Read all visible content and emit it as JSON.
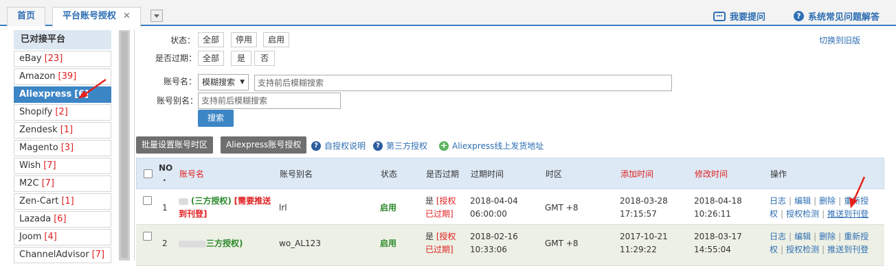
{
  "tabs": {
    "home": "首页",
    "active": "平台账号授权",
    "close": "✕"
  },
  "top_links": {
    "ask": "我要提问",
    "faq": "系统常见问题解答"
  },
  "sidebar": {
    "title": "已对接平台",
    "items": [
      {
        "name": "eBay",
        "count": "[23]"
      },
      {
        "name": "Amazon",
        "count": "[39]"
      },
      {
        "name": "Aliexpress",
        "count": "[6]"
      },
      {
        "name": "Shopify",
        "count": "[2]"
      },
      {
        "name": "Zendesk",
        "count": "[1]"
      },
      {
        "name": "Magento",
        "count": "[3]"
      },
      {
        "name": "Wish",
        "count": "[7]"
      },
      {
        "name": "M2C",
        "count": "[7]"
      },
      {
        "name": "Zen-Cart",
        "count": "[1]"
      },
      {
        "name": "Lazada",
        "count": "[6]"
      },
      {
        "name": "Joom",
        "count": "[4]"
      },
      {
        "name": "ChannelAdvisor",
        "count": "[7]"
      }
    ]
  },
  "filters": {
    "status_label": "状态：",
    "status_options": [
      "全部",
      "停用",
      "启用"
    ],
    "expired_label": "是否过期：",
    "expired_options": [
      "全部",
      "是",
      "否"
    ],
    "account_label": "账号名：",
    "search_mode": "模糊搜索",
    "account_placeholder": "支持前后模糊搜索",
    "alias_label": "账号别名：",
    "alias_placeholder": "支持前后模糊搜索",
    "search_button": "搜索",
    "switch_old": "切换到旧版"
  },
  "toolbar": {
    "batch_timezone": "批量设置账号时区",
    "aliexpress_auth": "Aliexpress账号授权",
    "self_auth": "自授权说明",
    "third_auth": "第三方授权",
    "ship_address": "Aliexpress线上发货地址"
  },
  "table": {
    "headers": {
      "no_top": "NO",
      "no_dot": ".",
      "account": "账号名",
      "alias": "账号别名",
      "status": "状态",
      "expired": "是否过期",
      "expire_time": "过期时间",
      "timezone": "时区",
      "added": "添加时间",
      "modified": "修改时间",
      "ops": "操作"
    },
    "rows": [
      {
        "no": "1",
        "account_tag": "(三方授权)",
        "account_note": "[需要推送到刊登]",
        "alias": "lrl",
        "status": "启用",
        "expired_yes": "是",
        "expired_note": "[授权已过期]",
        "expire_date": "2018-04-04",
        "expire_clock": "06:00:00",
        "timezone": "GMT +8",
        "added_date": "2018-03-28",
        "added_clock": "17:15:57",
        "mod_date": "2018-04-18",
        "mod_clock": "10:26:11",
        "ops": {
          "log": "日志",
          "edit": "编辑",
          "delete": "删除",
          "reauth": "重新授权",
          "check": "授权检测",
          "push": "推送到刊登"
        }
      },
      {
        "no": "2",
        "account_tag": "三方授权)",
        "alias": "wo_AL123",
        "status": "启用",
        "expired_yes": "是",
        "expired_note": "[授权已过期]",
        "expire_date": "2018-02-16",
        "expire_clock": "10:33:06",
        "timezone": "GMT +8",
        "added_date": "2017-10-21",
        "added_clock": "11:29:22",
        "mod_date": "2018-03-17",
        "mod_clock": "14:55:04",
        "ops": {
          "log": "日志",
          "edit": "编辑",
          "delete": "删除",
          "reauth": "重新授权",
          "check": "授权检测",
          "push": "推送到刊登"
        }
      }
    ]
  }
}
